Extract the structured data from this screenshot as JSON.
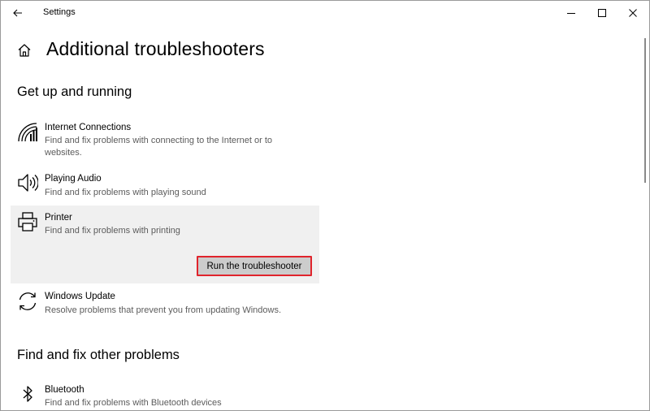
{
  "window": {
    "title": "Settings"
  },
  "header": {
    "title": "Additional troubleshooters"
  },
  "sections": [
    {
      "heading": "Get up and running",
      "items": [
        {
          "icon": "wifi-signal-icon",
          "title": "Internet Connections",
          "description": "Find and fix problems with connecting to the Internet or to websites."
        },
        {
          "icon": "speaker-icon",
          "title": "Playing Audio",
          "description": "Find and fix problems with playing sound"
        },
        {
          "icon": "printer-icon",
          "title": "Printer",
          "description": "Find and fix problems with printing",
          "button": "Run the troubleshooter"
        },
        {
          "icon": "sync-icon",
          "title": "Windows Update",
          "description": "Resolve problems that prevent you from updating Windows."
        }
      ]
    },
    {
      "heading": "Find and fix other problems",
      "items": [
        {
          "icon": "bluetooth-icon",
          "title": "Bluetooth",
          "description": "Find and fix problems with Bluetooth devices"
        }
      ]
    }
  ],
  "colors": {
    "selected_bg": "#f0f0f0",
    "button_bg": "#cccccc",
    "highlight_border": "#e0242c",
    "secondary_text": "#5c5c5c"
  }
}
